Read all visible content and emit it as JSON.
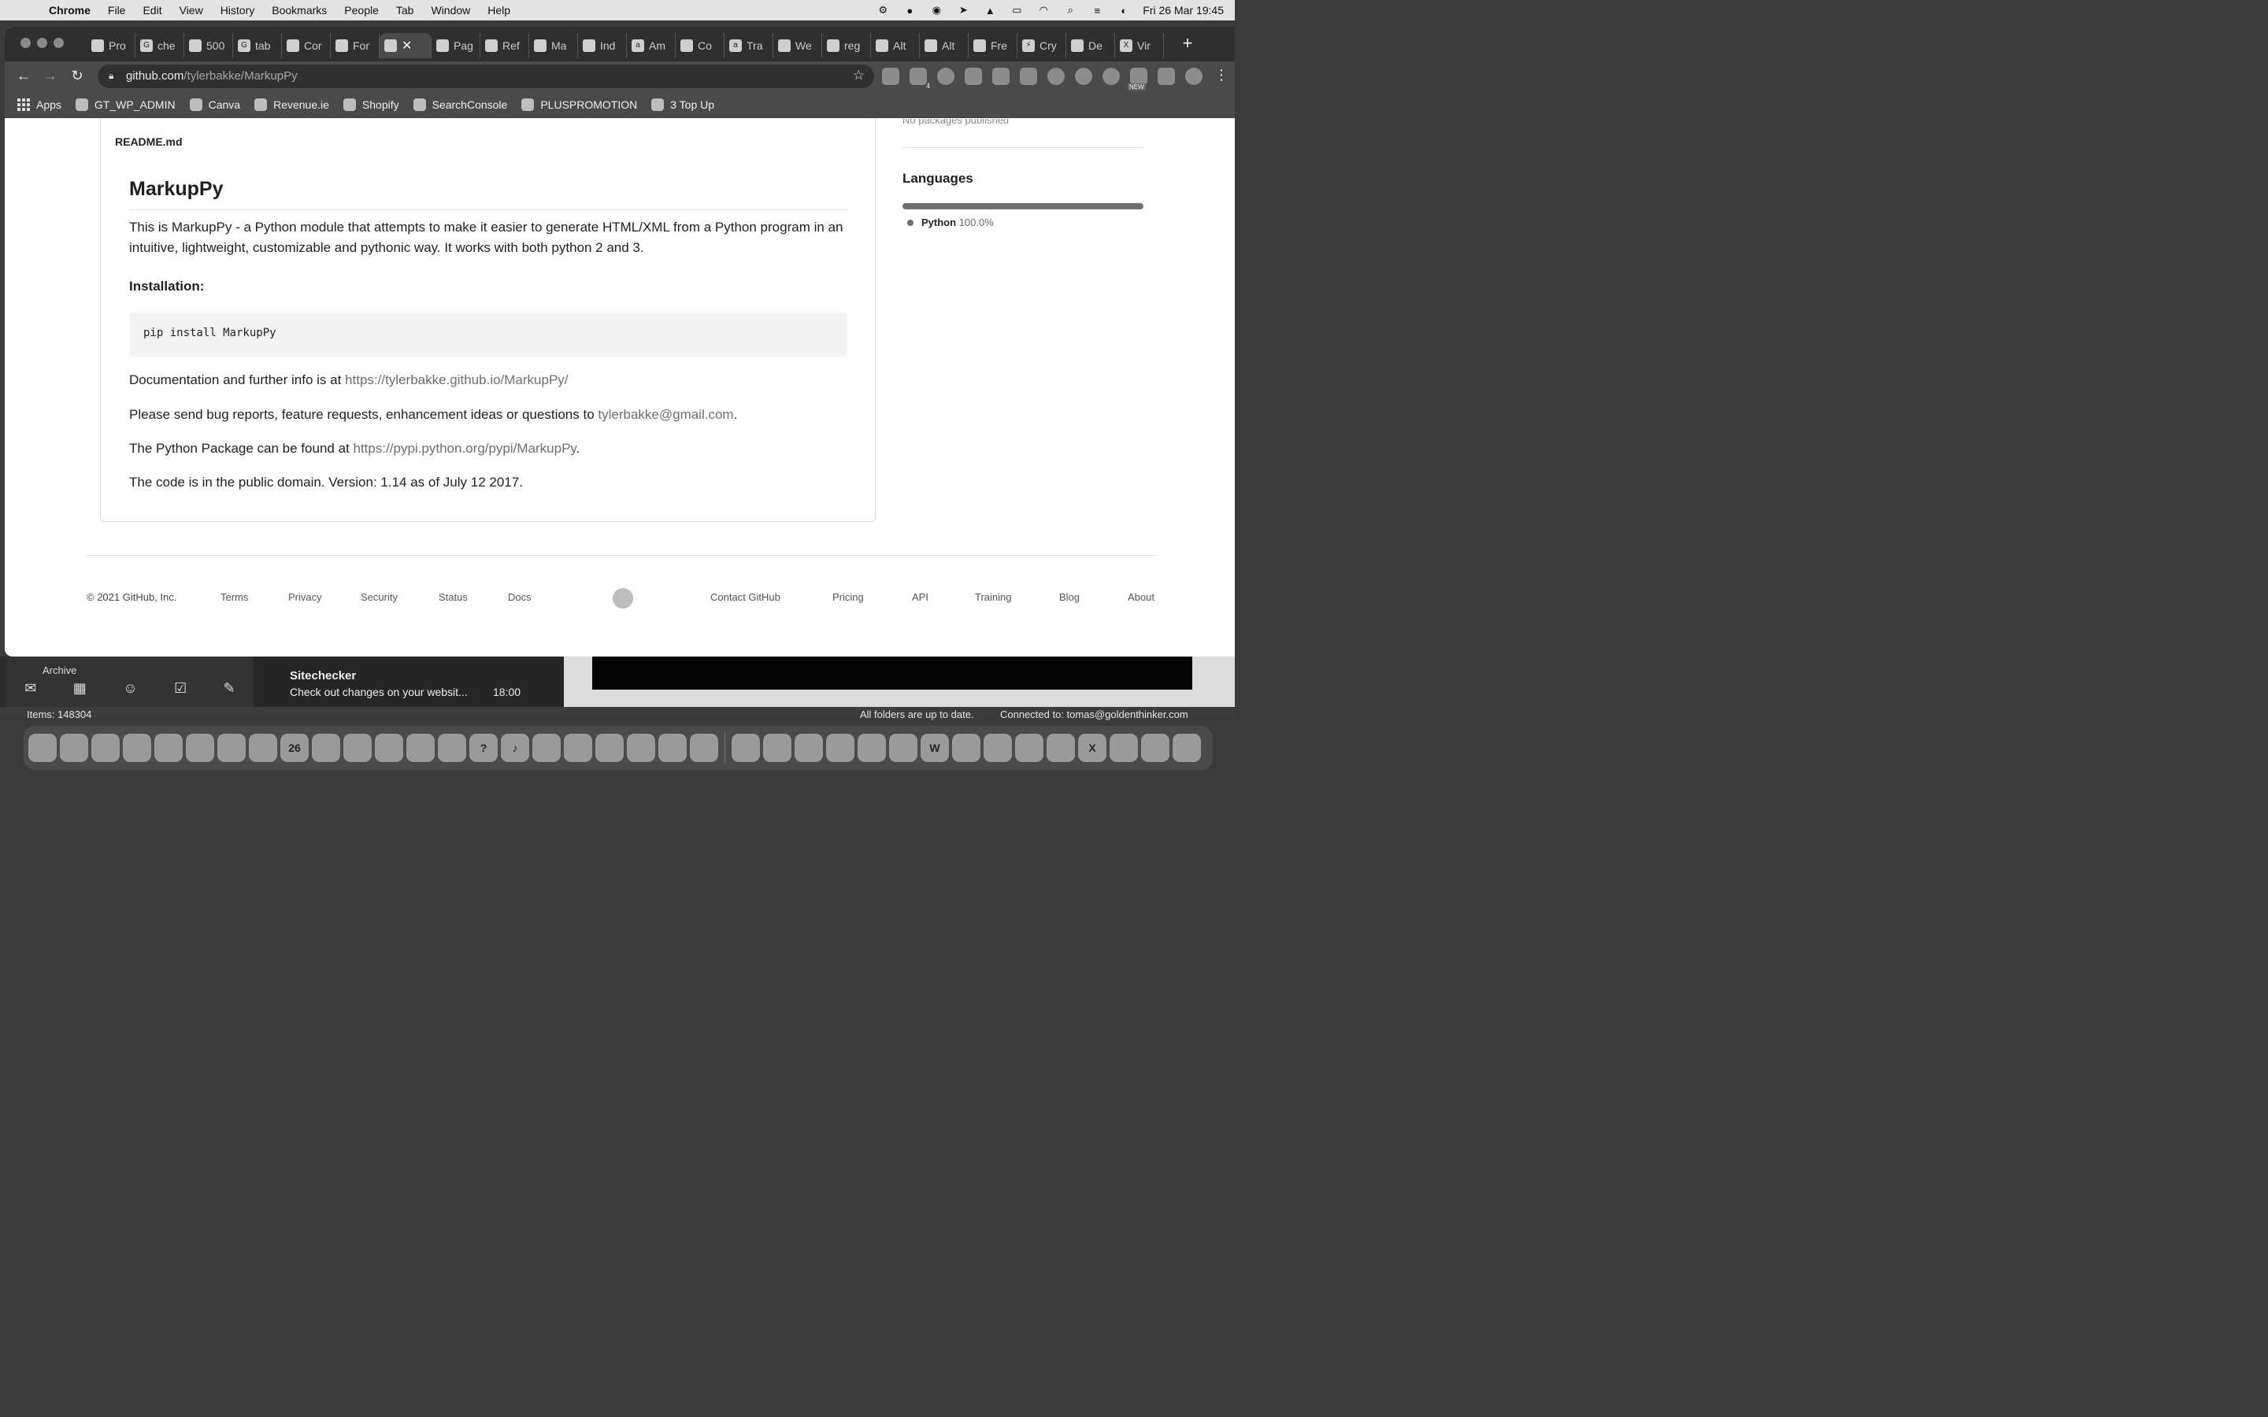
{
  "menubar": {
    "app": "Chrome",
    "items": [
      "File",
      "Edit",
      "View",
      "History",
      "Bookmarks",
      "People",
      "Tab",
      "Window",
      "Help"
    ],
    "datetime": "Fri 26 Mar  19:45"
  },
  "browser": {
    "tabs": [
      {
        "label": "Pro"
      },
      {
        "label": "che"
      },
      {
        "label": "500"
      },
      {
        "label": "tab"
      },
      {
        "label": "Cor"
      },
      {
        "label": "For"
      },
      {
        "label": "",
        "active": true
      },
      {
        "label": "Pag"
      },
      {
        "label": "Ref"
      },
      {
        "label": "Ma"
      },
      {
        "label": "Ind"
      },
      {
        "label": "Am"
      },
      {
        "label": "Co"
      },
      {
        "label": "Tra"
      },
      {
        "label": "We"
      },
      {
        "label": "reg"
      },
      {
        "label": "Alt"
      },
      {
        "label": "Alt"
      },
      {
        "label": "Fre"
      },
      {
        "label": "Cry"
      },
      {
        "label": "De"
      },
      {
        "label": "Vir"
      }
    ],
    "url_host": "github.com",
    "url_path": "/tylerbakke/MarkupPy",
    "extension_badges": {
      "four": "4",
      "new": "NEW"
    },
    "bookmarks": [
      "Apps",
      "GT_WP_ADMIN",
      "Canva",
      "Revenue.ie",
      "Shopify",
      "SearchConsole",
      "PLUSPROMOTION",
      "3 Top Up"
    ]
  },
  "readme": {
    "label": "README.md",
    "title": "MarkupPy",
    "intro": "This is MarkupPy - a Python module that attempts to make it easier to generate HTML/XML from a Python program in an intuitive, lightweight, customizable and pythonic way. It works with both python 2 and 3.",
    "install_heading": "Installation:",
    "install_cmd": "pip install MarkupPy",
    "docs_text": "Documentation and further info is at ",
    "docs_link": "https://tylerbakke.github.io/MarkupPy/",
    "bugs_text": "Please send bug reports, feature requests, enhancement ideas or questions to ",
    "bugs_link": "tylerbakke@gmail.com",
    "bugs_end": ".",
    "pypi_text": "The Python Package can be found at ",
    "pypi_link": "https://pypi.python.org/pypi/MarkupPy",
    "pypi_end": ".",
    "license": "The code is in the public domain. Version: 1.14 as of July 12 2017."
  },
  "sidebar": {
    "packages_text": "No packages published",
    "languages_title": "Languages",
    "language_name": "Python",
    "language_pct": "100.0%",
    "language_fraction": 1.0
  },
  "footer": {
    "copyright": "© 2021 GitHub, Inc.",
    "links_left": [
      "Terms",
      "Privacy",
      "Security",
      "Status",
      "Docs"
    ],
    "links_right": [
      "Contact GitHub",
      "Pricing",
      "API",
      "Training",
      "Blog",
      "About"
    ]
  },
  "background": {
    "folder": "Archive",
    "mail_sender": "Sitechecker",
    "mail_preview": "Check out changes on your websit...",
    "mail_time": "18:00",
    "items_count": "Items: 148304",
    "folders_status": "All folders are up to date.",
    "connection": "Connected to: tomas@goldenthinker.com"
  },
  "dock": {
    "calendar_day": "26"
  }
}
